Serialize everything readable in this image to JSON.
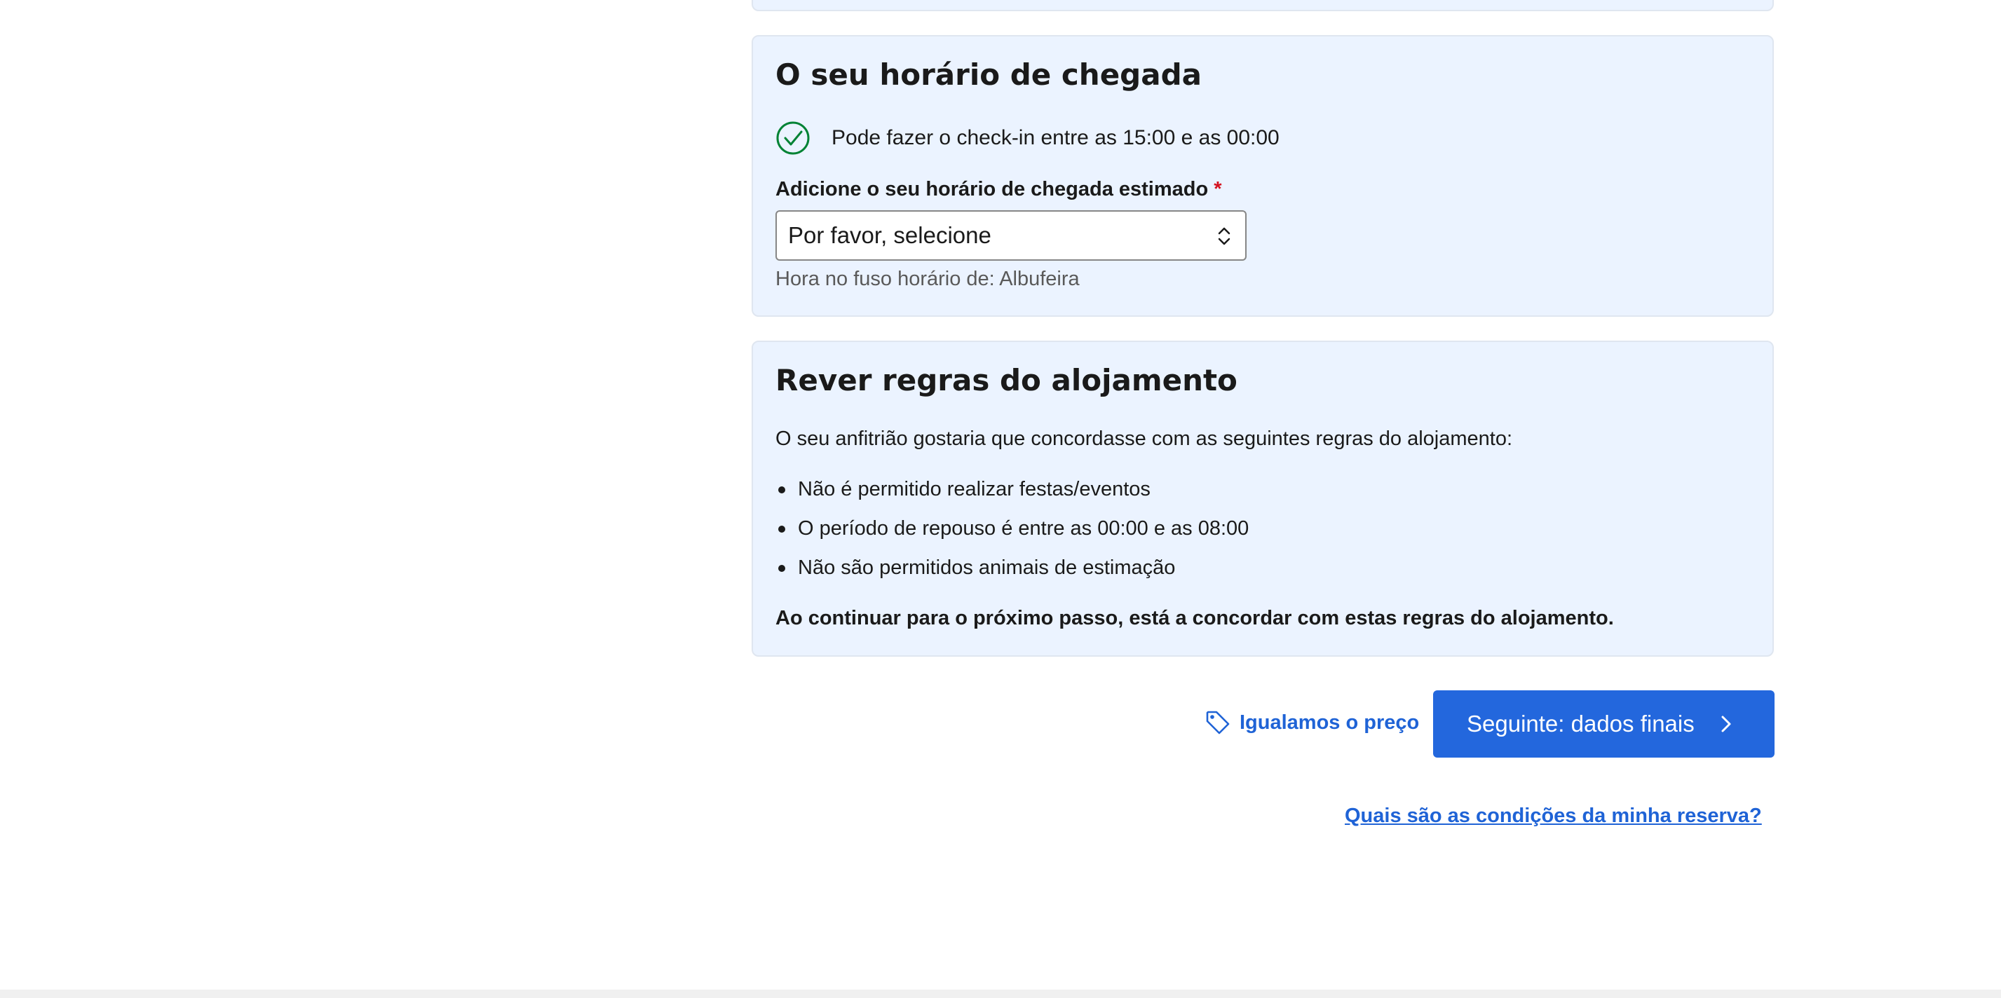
{
  "arrival": {
    "title": "O seu horário de chegada",
    "checkin_text": "Pode fazer o check-in entre as 15:00 e as 00:00",
    "field_label": "Adicione o seu horário de chegada estimado",
    "required_mark": "*",
    "select_value": "Por favor, selecione",
    "timezone_hint": "Hora no fuso horário de: Albufeira"
  },
  "rules": {
    "title": "Rever regras do alojamento",
    "intro": "O seu anfitrião gostaria que concordasse com as seguintes regras do alojamento:",
    "items": [
      "Não é permitido realizar festas/eventos",
      "O período de repouso é entre as 00:00 e as 08:00",
      "Não são permitidos animais de estimação"
    ],
    "note": "Ao continuar para o próximo passo, está a concordar com estas regras do alojamento."
  },
  "actions": {
    "price_match_label": "Igualamos o preço",
    "next_button_label": "Seguinte: dados finais",
    "conditions_link": "Quais são as condições da minha reserva?"
  },
  "colors": {
    "card_background": "#ebf3ff",
    "primary_blue": "#2367dd",
    "link_blue": "#1f63d6",
    "success_green": "#008234",
    "required_red": "#d4111e"
  },
  "icons": {
    "checkin": "check-circle-icon",
    "select": "select-arrows-icon",
    "price_match": "tag-icon",
    "next": "chevron-right-icon"
  }
}
